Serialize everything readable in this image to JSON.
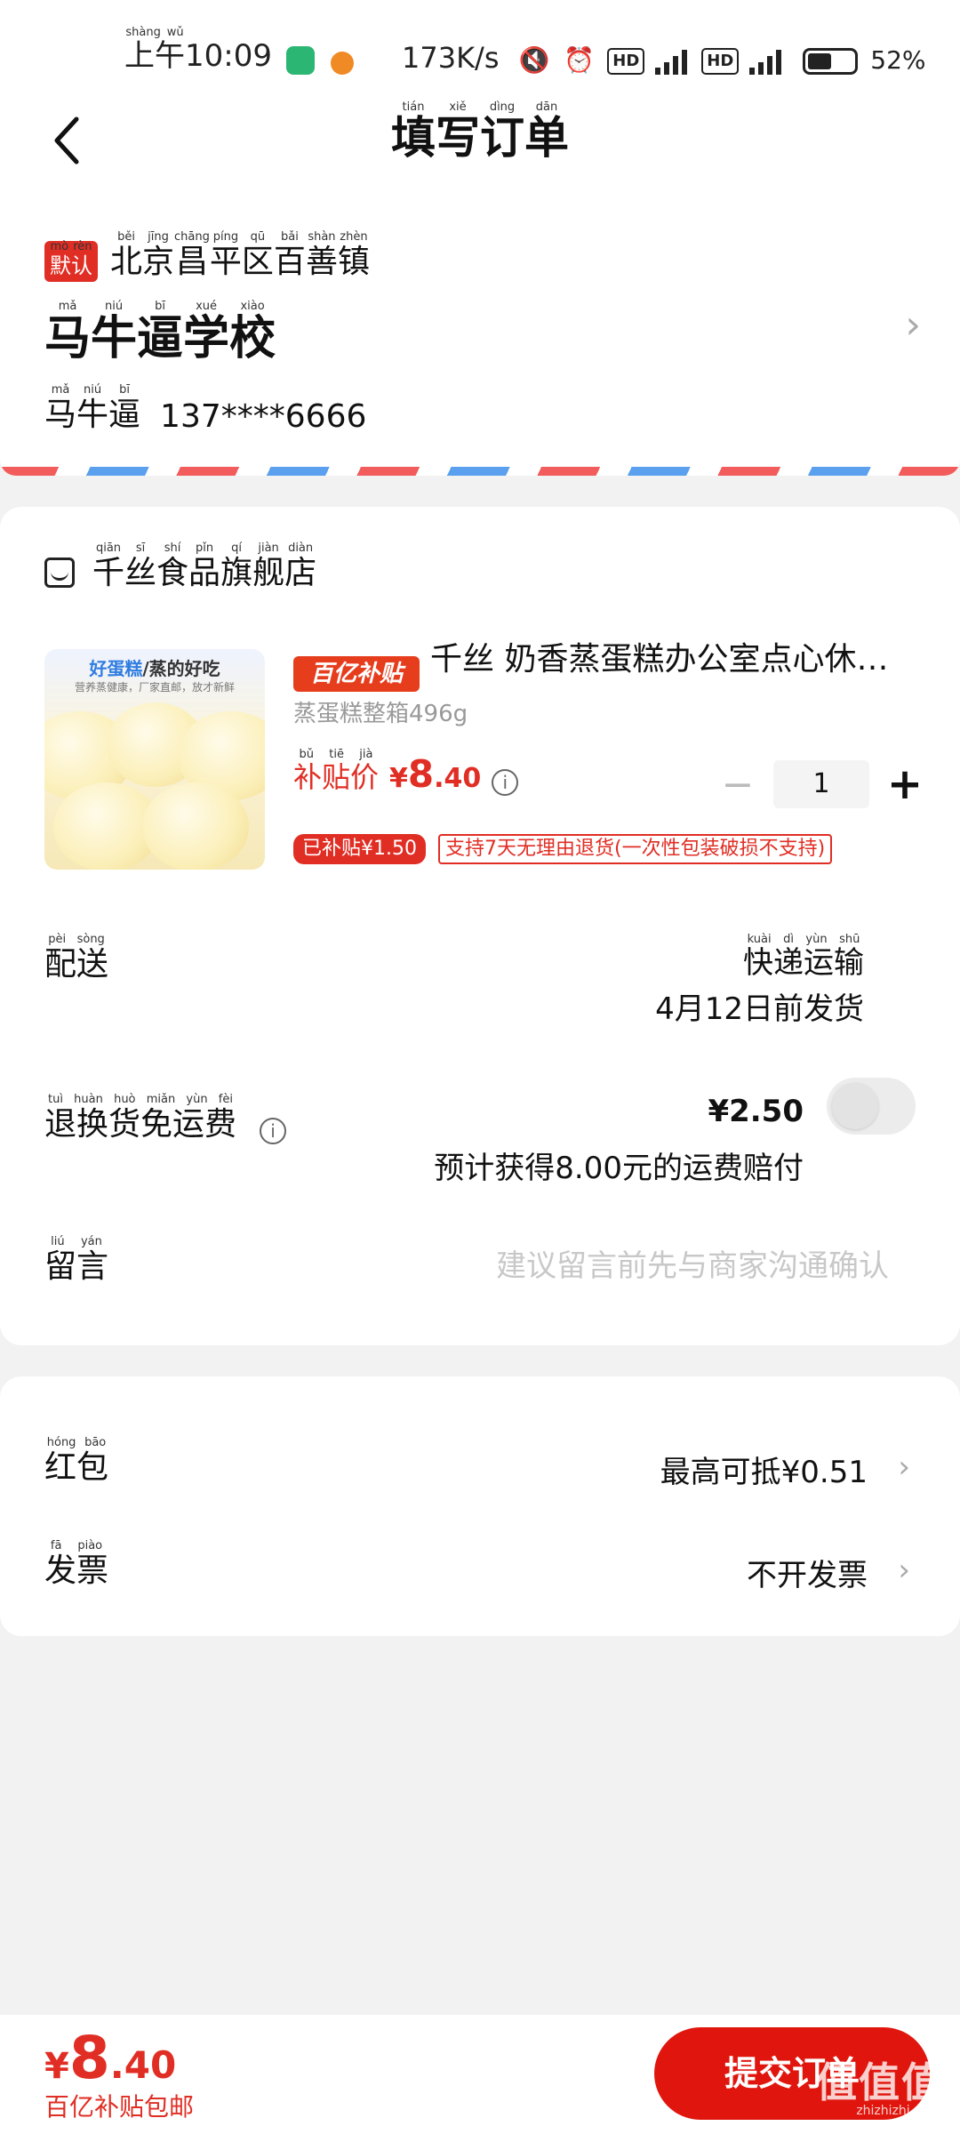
{
  "status_bar": {
    "time_prefix": "上午",
    "time_prefix_ruby": "shàng wǔ",
    "time": "10:09",
    "speed": "173K/s",
    "badge_hd": "HD",
    "net_4g": "4G",
    "net_5g": "5G",
    "battery": "52%"
  },
  "header": {
    "title_chars": [
      {
        "c": "填",
        "py": "tián"
      },
      {
        "c": "写",
        "py": "xiě"
      },
      {
        "c": "订",
        "py": "dìng"
      },
      {
        "c": "单",
        "py": "dān"
      }
    ]
  },
  "address": {
    "default_badge": "默认",
    "default_badge_ruby": "mò rèn",
    "region_chars": [
      {
        "c": "北",
        "py": "běi"
      },
      {
        "c": "京",
        "py": "jīng"
      },
      {
        "c": "昌",
        "py": "chāng"
      },
      {
        "c": "平",
        "py": "píng"
      },
      {
        "c": "区",
        "py": "qū"
      },
      {
        "c": "百",
        "py": "bǎi"
      },
      {
        "c": "善",
        "py": "shàn"
      },
      {
        "c": "镇",
        "py": "zhèn"
      }
    ],
    "place_chars": [
      {
        "c": "马",
        "py": "mǎ"
      },
      {
        "c": "牛",
        "py": "niú"
      },
      {
        "c": "逼",
        "py": "bī"
      },
      {
        "c": "学",
        "py": "xué"
      },
      {
        "c": "校",
        "py": "xiào"
      }
    ],
    "name_chars": [
      {
        "c": "马",
        "py": "mǎ"
      },
      {
        "c": "牛",
        "py": "niú"
      },
      {
        "c": "逼",
        "py": "bī"
      }
    ],
    "phone": "137****6666"
  },
  "store": {
    "name_chars": [
      {
        "c": "千",
        "py": "qiān"
      },
      {
        "c": "丝",
        "py": "sī"
      },
      {
        "c": "食",
        "py": "shí"
      },
      {
        "c": "品",
        "py": "pǐn"
      },
      {
        "c": "旗",
        "py": "qí"
      },
      {
        "c": "舰",
        "py": "jiàn"
      },
      {
        "c": "店",
        "py": "diàn"
      }
    ]
  },
  "product": {
    "image_caption_a": "好蛋糕",
    "image_caption_b": "/蒸的好吃",
    "image_sub": "营养蒸健康，厂家直邮，放才新鲜",
    "badge": "百亿补贴",
    "title": "千丝 奶香蒸蛋糕办公室点心休…",
    "spec": "蒸蛋糕整箱496g",
    "price_label": "补贴价",
    "price_label_ruby": "bǔ tiē jià",
    "price_currency": "¥",
    "price_int": "8",
    "price_dec": ".40",
    "quantity": "1",
    "tag_subsidy": "已补贴¥1.50",
    "tag_return": "支持7天无理由退货(一次性包装破损不支持)"
  },
  "delivery": {
    "label": "配送",
    "label_ruby": "pèi sòng",
    "method": "快递运输",
    "method_ruby": "kuài dì yùn shū",
    "ship_date": "4月12日前发货"
  },
  "return_shipping": {
    "label": "退换货免运费",
    "label_ruby": "tuì huàn huò miǎn yùn fèi",
    "fee": "¥2.50",
    "note": "预计获得8.00元的运费赔付"
  },
  "message": {
    "label": "留言",
    "label_ruby": "liú yán",
    "placeholder": "建议留言前先与商家沟通确认"
  },
  "options": {
    "red_packet_label": "红包",
    "red_packet_ruby": "hóng bāo",
    "red_packet_value": "最高可抵¥0.51",
    "invoice_label": "发票",
    "invoice_ruby": "fā piào",
    "invoice_value": "不开发票"
  },
  "footer": {
    "total_currency": "¥",
    "total_int": "8",
    "total_dec": ".40",
    "total_note": "百亿补贴包邮",
    "submit_label": "提交订单",
    "watermark": "值值值",
    "watermark_sub": "zhizhizhi.com"
  },
  "colors": {
    "accent_red": "#e02e24",
    "airmail_red": "#f25c5c",
    "airmail_blue": "#5aa0ef"
  }
}
